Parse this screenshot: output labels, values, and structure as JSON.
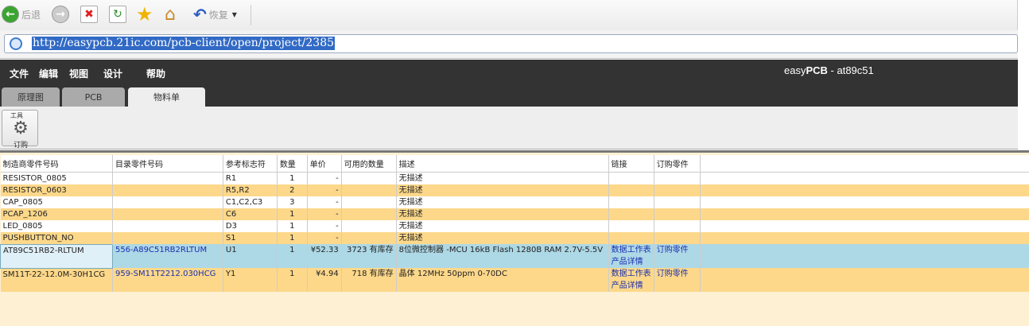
{
  "browser": {
    "back_label": "后退",
    "restore_label": "恢复",
    "url": "http://easypcb.21ic.com/pcb-client/open/project/2385"
  },
  "app": {
    "menu": [
      "文件",
      "编辑",
      "视图",
      "设计",
      "帮助"
    ],
    "title_prefix": "easy",
    "title_bold": "PCB",
    "title_suffix": " - at89c51",
    "tabs": [
      {
        "label": "原理图",
        "active": false
      },
      {
        "label": "PCB",
        "active": false
      },
      {
        "label": "物料单",
        "active": true
      }
    ],
    "toolbar": {
      "group_label": "工具",
      "order_label": "订购"
    }
  },
  "bom": {
    "headers": [
      "制造商零件号码",
      "目录零件号码",
      "参考标志符",
      "数量",
      "单价",
      "可用的数量",
      "描述",
      "链接",
      "订购零件"
    ],
    "rows": [
      {
        "mfr": "RESISTOR_0805",
        "catalog": "",
        "ref": "R1",
        "qty": "1",
        "price": "-",
        "avail": "",
        "desc": "无描述",
        "link1": "",
        "link2": "",
        "order": ""
      },
      {
        "mfr": "RESISTOR_0603",
        "catalog": "",
        "ref": "R5,R2",
        "qty": "2",
        "price": "-",
        "avail": "",
        "desc": "无描述",
        "link1": "",
        "link2": "",
        "order": ""
      },
      {
        "mfr": "CAP_0805",
        "catalog": "",
        "ref": "C1,C2,C3",
        "qty": "3",
        "price": "-",
        "avail": "",
        "desc": "无描述",
        "link1": "",
        "link2": "",
        "order": ""
      },
      {
        "mfr": "PCAP_1206",
        "catalog": "",
        "ref": "C6",
        "qty": "1",
        "price": "-",
        "avail": "",
        "desc": "无描述",
        "link1": "",
        "link2": "",
        "order": ""
      },
      {
        "mfr": "LED_0805",
        "catalog": "",
        "ref": "D3",
        "qty": "1",
        "price": "-",
        "avail": "",
        "desc": "无描述",
        "link1": "",
        "link2": "",
        "order": ""
      },
      {
        "mfr": "PUSHBUTTON_NO",
        "catalog": "",
        "ref": "S1",
        "qty": "1",
        "price": "-",
        "avail": "",
        "desc": "无描述",
        "link1": "",
        "link2": "",
        "order": ""
      },
      {
        "mfr": "AT89C51RB2-RLTUM",
        "catalog": "556-A89C51RB2RLTUM",
        "ref": "U1",
        "qty": "1",
        "price": "¥52.33",
        "avail": "3723 有库存",
        "desc": "8位微控制器 -MCU 16kB Flash 1280B RAM 2.7V-5.5V",
        "link1": "数据工作表",
        "link2": "产品详情",
        "order": "订购零件"
      },
      {
        "mfr": "SM11T-22-12.0M-30H1CG",
        "catalog": "959-SM11T2212.030HCG",
        "ref": "Y1",
        "qty": "1",
        "price": "¥4.94",
        "avail": "718 有库存",
        "desc": "晶体 12MHz 50ppm 0-70DC",
        "link1": "数据工作表",
        "link2": "产品详情",
        "order": "订购零件"
      }
    ]
  }
}
